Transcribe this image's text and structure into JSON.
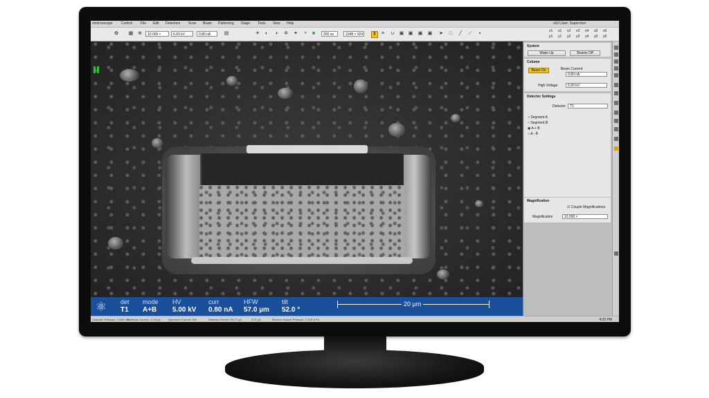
{
  "menubar": {
    "app_title": "xtmicroscope",
    "items": [
      "Control",
      "File",
      "Edit",
      "Detectors",
      "Scan",
      "Beam",
      "Patterning",
      "Stage",
      "Tools",
      "View",
      "Help"
    ],
    "right_info": "xtUI  User: Supervisor"
  },
  "toolbar": {
    "magnification": "10 000 ×",
    "voltage": "5.00 kV",
    "current": "0.80 nA",
    "dwell": "200 ns",
    "resolution": "1048 × 924",
    "quads": [
      "x1",
      "x1",
      "x2",
      "x3",
      "x4",
      "x5",
      "x6",
      "y1",
      "y1",
      "y2",
      "y3",
      "y4",
      "y5",
      "y6"
    ]
  },
  "databar": {
    "det_label": "det",
    "det_value": "T1",
    "mode_label": "mode",
    "mode_value": "A+B",
    "hv_label": "HV",
    "hv_value": "5.00 kV",
    "curr_label": "curr",
    "curr_value": "0.80 nA",
    "hfw_label": "HFW",
    "hfw_value": "57.0 µm",
    "tilt_label": "tilt",
    "tilt_value": "52.0 °",
    "scale": "20 µm"
  },
  "statusbar": {
    "items": [
      "Chamber Pressure: 2.32E-4 Pa",
      "Ion Beam Current: -0.03 pA",
      "Specimen Current: N/A",
      "Detector Current: 99.17 µA",
      "2.07 µA",
      "Electron Source Pressure: 1.02E-6 Pa"
    ],
    "time": "4:20 PM"
  },
  "panel": {
    "system": {
      "title": "System",
      "wake_up": "Wake Up",
      "beams_off": "Beams Off"
    },
    "column": {
      "title": "Column",
      "beam_on": "Beam On",
      "beam_current_label": "Beam Current",
      "beam_current": "0.80 nA",
      "hv_label": "High Voltage",
      "hv_value": "5.00 kV"
    },
    "detector": {
      "title": "Detector Settings",
      "detector_label": "Detector",
      "detector_value": "T1",
      "segments": [
        "Segment A",
        "Segment B",
        "A + B",
        "A - B"
      ],
      "selected": "A + B"
    },
    "magnification": {
      "title": "Magnification",
      "couple": "Couple Magnifications",
      "mag_label": "Magnification",
      "mag_value": "10 000 ×"
    }
  },
  "colors": {
    "databar": "#1a4f9c",
    "beam_on": "#f4c21a",
    "pause": "#28c828"
  }
}
